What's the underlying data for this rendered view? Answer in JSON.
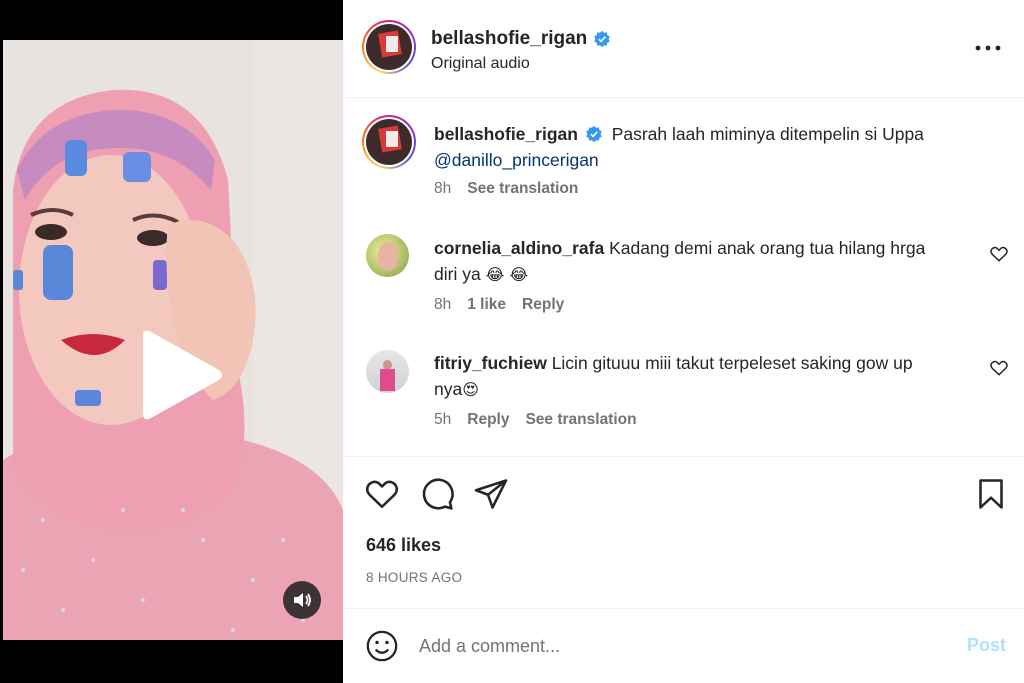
{
  "post": {
    "author": "bellashofie_rigan",
    "audio": "Original audio",
    "caption_text": "Pasrah laah miminya ditempelin si Uppa",
    "caption_mention": "@danillo_princerigan",
    "caption_time": "8h",
    "caption_translate": "See translation",
    "likes": "646 likes",
    "posted_ago": "8 HOURS AGO"
  },
  "comments": [
    {
      "user": "cornelia_aldino_rafa",
      "text_line1": "Kadang demi anak orang tua hilang hrga",
      "text_line2": "diri ya",
      "emoji": "😂 😂",
      "time": "8h",
      "likes": "1 like",
      "reply": "Reply"
    },
    {
      "user": "fitriy_fuchiew",
      "text_line1": "Licin gituuu miii takut terpeleset saking gow up",
      "text_line2": "nya",
      "emoji": "😍",
      "time": "5h",
      "reply": "Reply",
      "translate": "See translation"
    }
  ],
  "comment_box": {
    "placeholder": "Add a comment...",
    "post_label": "Post"
  },
  "icons": {
    "verified": "verified-badge-icon",
    "more": "more-options-icon",
    "like": "heart-icon",
    "comment": "comment-icon",
    "share": "share-icon",
    "save": "bookmark-icon",
    "emoji": "emoji-icon",
    "play": "play-icon",
    "sound": "sound-icon"
  },
  "colors": {
    "verified_blue": "#3897f0",
    "link_blue": "#00376b",
    "post_disabled": "#b2dffc",
    "muted": "#737373"
  }
}
